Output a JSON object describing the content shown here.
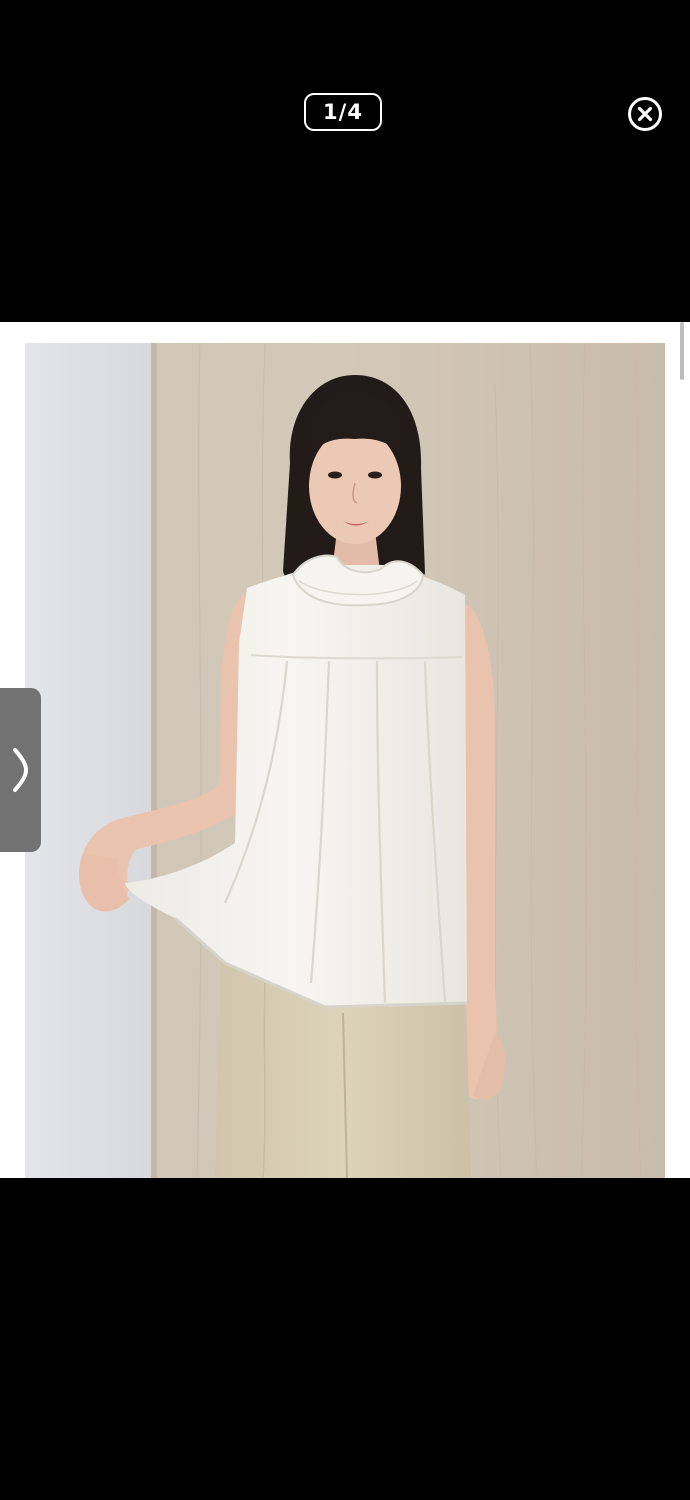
{
  "viewer": {
    "counter": "1/4",
    "close_icon": "close-circle-icon",
    "next_icon": "chevron-right-icon"
  },
  "photo": {
    "subject": "model-in-sleeveless-white-pleated-blouse",
    "colors": {
      "wall_left": "#dfe0e4",
      "wood_panel": "#cdc2b2",
      "blouse": "#f4f2ec",
      "trousers": "#d8cfb6",
      "hair": "#231c19",
      "skin": "#e9c6b2"
    }
  },
  "colors": {
    "background": "#000000",
    "frame": "#ffffff",
    "tab": "#727272",
    "scrollbar": "#bdbdbd"
  }
}
